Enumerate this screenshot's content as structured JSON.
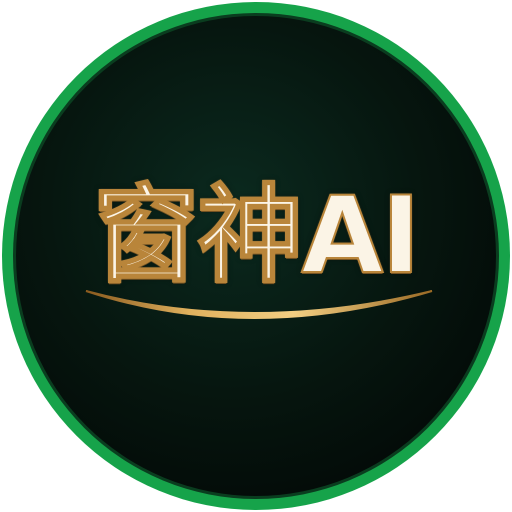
{
  "logo": {
    "text": "窗神AI",
    "colors": {
      "ring": "#16a34a",
      "background_inner": "#0b2a1f",
      "background_outer": "#030806",
      "text_fill": "#fbf4e6",
      "text_outline": "#b9853a",
      "swoosh_gold": "#d4a24c"
    }
  }
}
